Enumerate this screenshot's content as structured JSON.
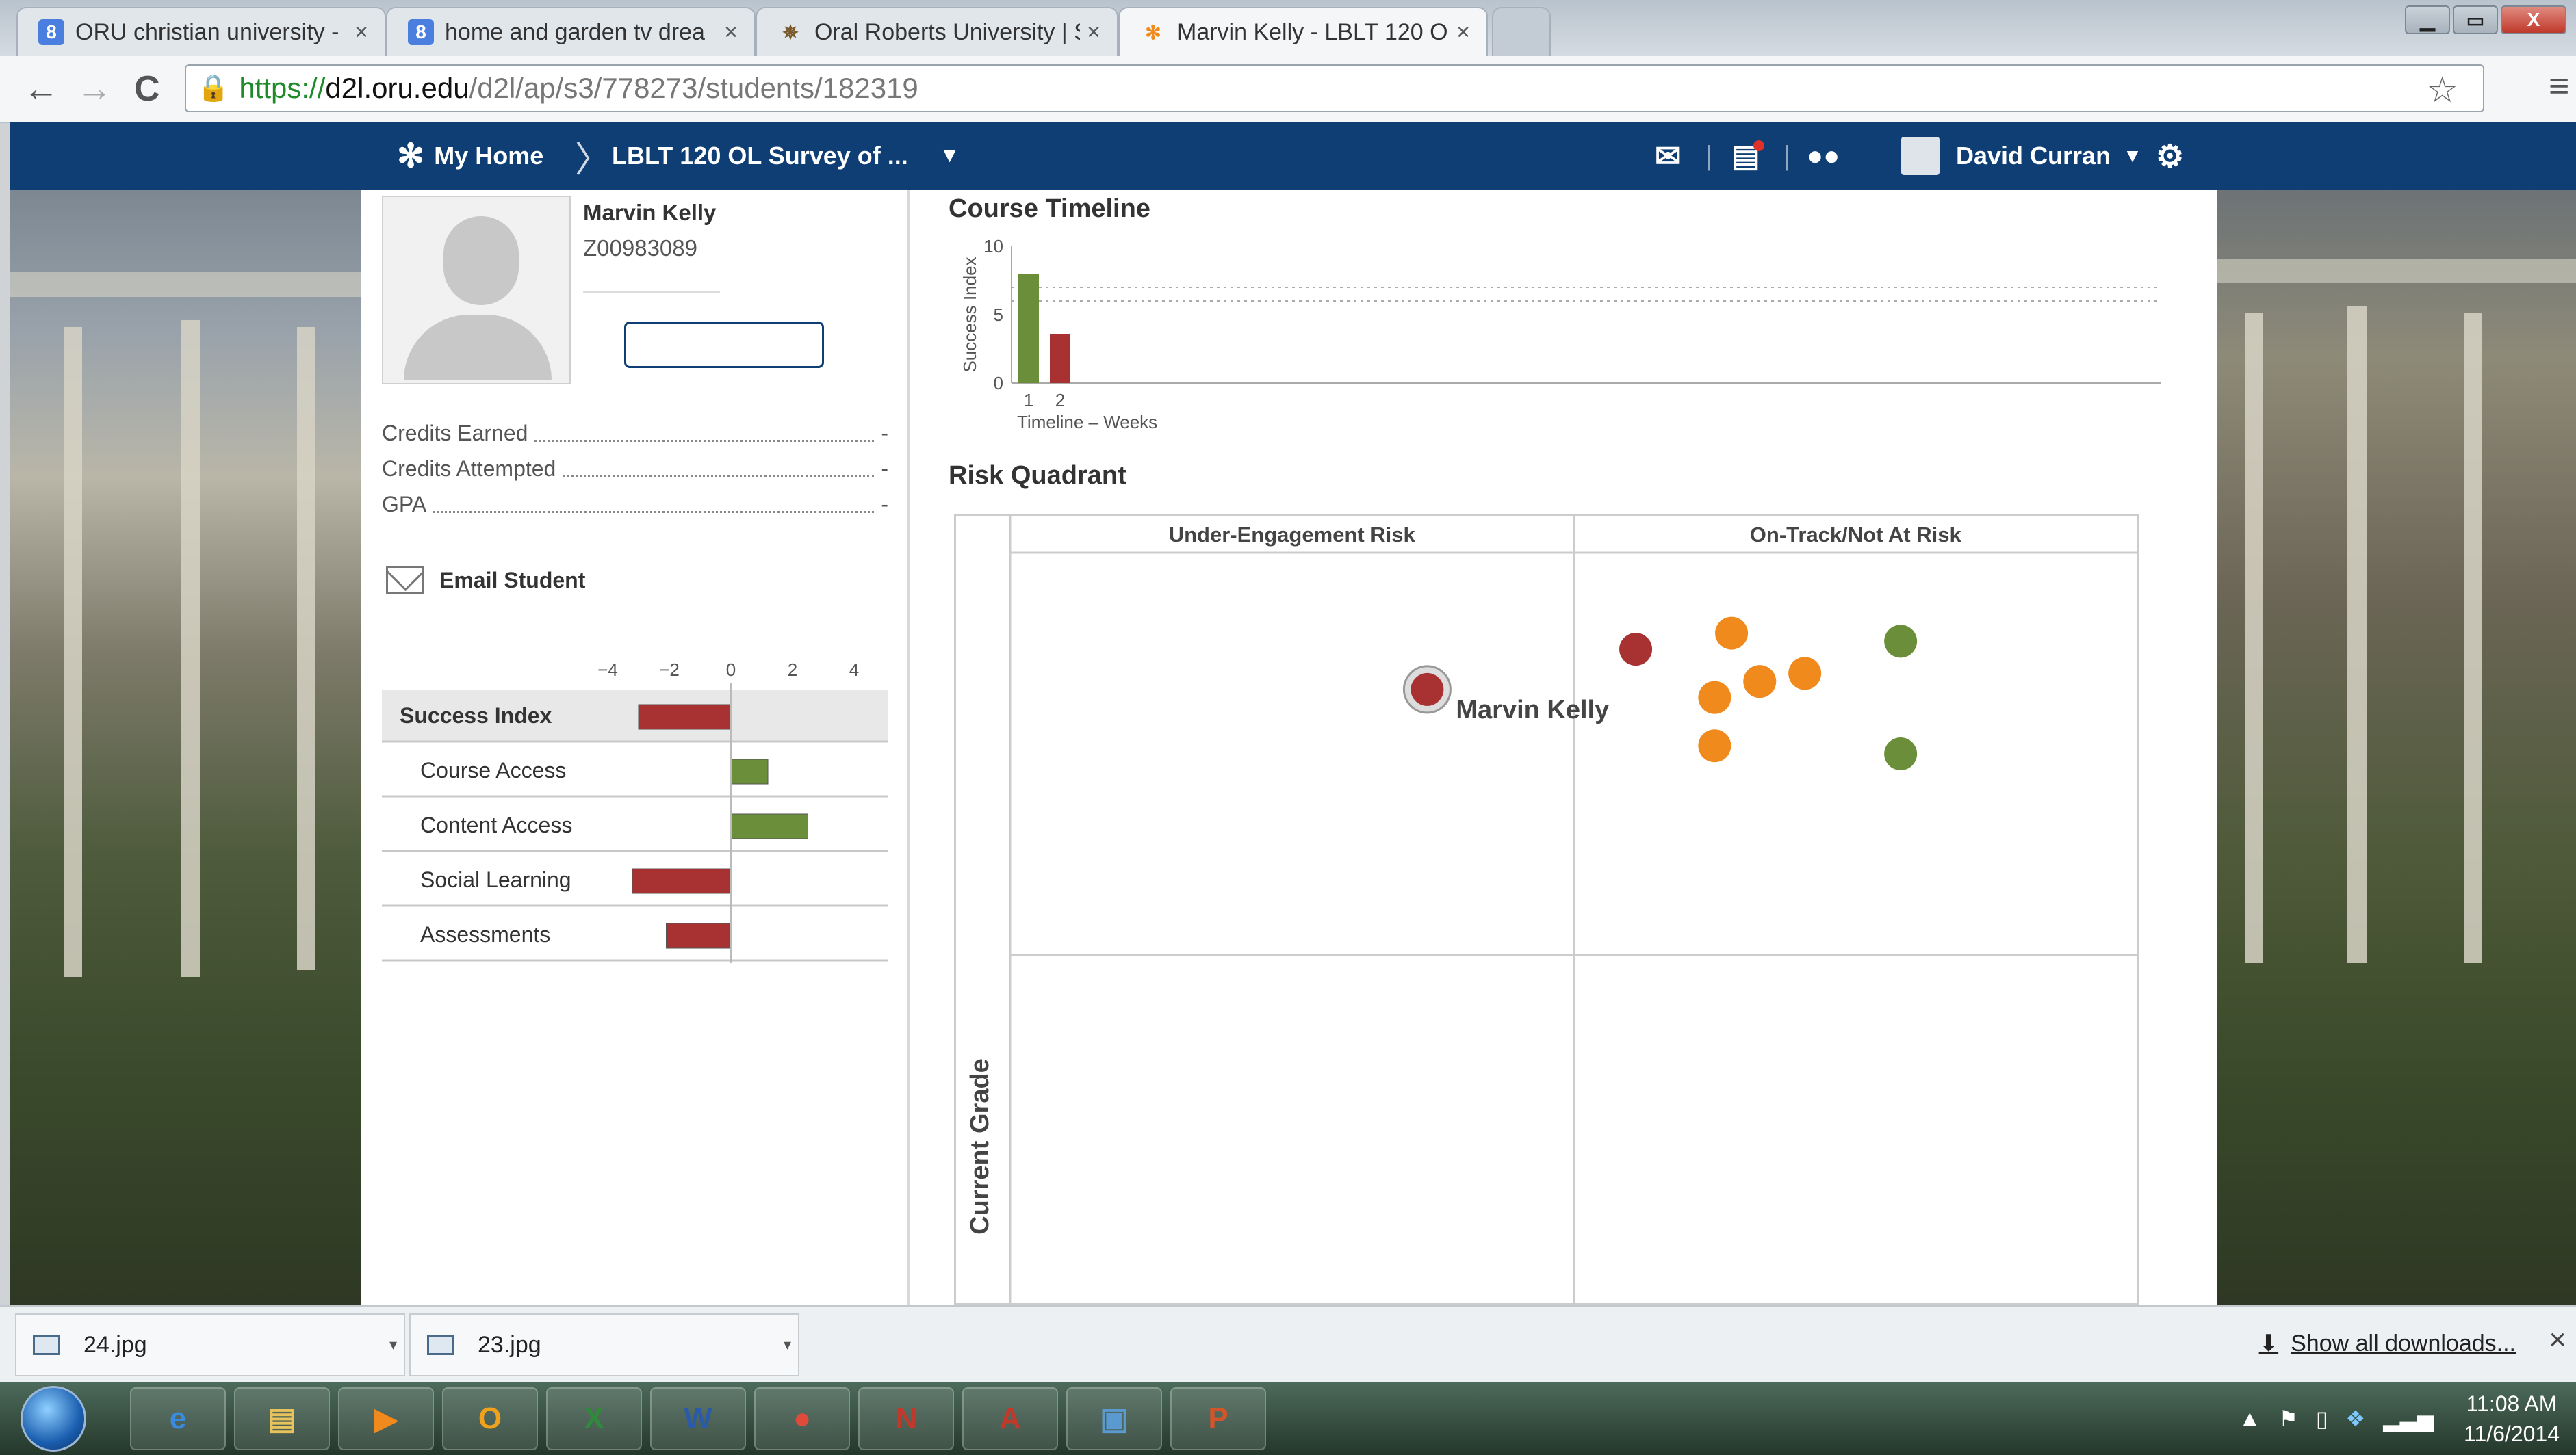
{
  "browser": {
    "tabs": [
      {
        "title": "ORU christian university -",
        "icon": "google-icon",
        "icon_glyph": "8",
        "icon_color": "#4a7fe0"
      },
      {
        "title": "home and garden tv drea",
        "icon": "google-icon",
        "icon_glyph": "8",
        "icon_color": "#4a7fe0"
      },
      {
        "title": "Oral Roberts University | S",
        "icon": "oru-icon",
        "icon_glyph": "✵",
        "icon_color": "#7a5a2a"
      },
      {
        "title": "Marvin Kelly - LBLT 120 O",
        "icon": "d2l-icon",
        "icon_glyph": "✻",
        "icon_color": "#f08a1c"
      }
    ],
    "tab_close": "×",
    "url_scheme": "https://",
    "url_host": "d2l.oru.edu",
    "url_path": "/d2l/ap/s3/778273/students/182319",
    "nav_back": "←",
    "nav_forward": "→",
    "nav_reload": "C",
    "window_minimize": "▁",
    "window_restore": "▭",
    "window_close": "X"
  },
  "navbar": {
    "home_label": "My Home",
    "course_label": "LBLT 120 OL Survey of ...",
    "user_name": "David Curran",
    "colors": {
      "bar": "#0e3e73"
    }
  },
  "student": {
    "name": "Marvin Kelly",
    "id": "Z00983089",
    "stats": [
      {
        "label": "Credits Earned",
        "value": "-"
      },
      {
        "label": "Credits Attempted",
        "value": "-"
      },
      {
        "label": "GPA",
        "value": "-"
      }
    ],
    "email_label": "Email Student"
  },
  "success_chart": {
    "axis_ticks": [
      "−4",
      "−2",
      "0",
      "2",
      "4"
    ],
    "axis_range": [
      -4,
      4
    ],
    "rows": [
      {
        "label": "Success Index",
        "value": -3.0,
        "bold": true
      },
      {
        "label": "Course Access",
        "value": 1.2
      },
      {
        "label": "Content Access",
        "value": 2.5
      },
      {
        "label": "Social Learning",
        "value": -3.2
      },
      {
        "label": "Assessments",
        "value": -2.1
      }
    ],
    "colors": {
      "positive": "#6b8e3a",
      "negative": "#a83232"
    }
  },
  "chart_data": [
    {
      "type": "bar",
      "title": "Course Timeline",
      "ylabel": "Success Index",
      "xlabel": "Timeline – Weeks",
      "categories": [
        "1",
        "2"
      ],
      "values": [
        8,
        3.6
      ],
      "ylim": [
        0,
        10
      ],
      "yticks": [
        "0",
        "5",
        "10"
      ],
      "colors": [
        "#6b8e3a",
        "#a83232"
      ],
      "grid": "dotted"
    },
    {
      "type": "scatter",
      "title": "Risk Quadrant",
      "ylabel": "Current Grade",
      "quadrant_labels": [
        "Under-Engagement Risk",
        "On-Track/Not At Risk"
      ],
      "highlight_label": "Marvin Kelly",
      "points": [
        {
          "x": 0.74,
          "y": 0.66,
          "color": "#a83232",
          "highlight": true
        },
        {
          "x": 1.11,
          "y": 0.76,
          "color": "#a83232"
        },
        {
          "x": 1.28,
          "y": 0.8,
          "color": "#f08a1c"
        },
        {
          "x": 1.58,
          "y": 0.78,
          "color": "#6b8e3a"
        },
        {
          "x": 1.41,
          "y": 0.7,
          "color": "#f08a1c"
        },
        {
          "x": 1.33,
          "y": 0.68,
          "color": "#f08a1c"
        },
        {
          "x": 1.25,
          "y": 0.64,
          "color": "#f08a1c"
        },
        {
          "x": 1.25,
          "y": 0.52,
          "color": "#f08a1c"
        },
        {
          "x": 1.58,
          "y": 0.5,
          "color": "#6b8e3a"
        }
      ],
      "xlim": [
        0,
        2
      ],
      "ylim": [
        -1,
        1
      ]
    }
  ],
  "downloads": {
    "items": [
      {
        "name": "24.jpg"
      },
      {
        "name": "23.jpg"
      }
    ],
    "show_all": "Show all downloads...",
    "close": "×"
  },
  "taskbar": {
    "apps": [
      {
        "name": "internet-explorer",
        "glyph": "e",
        "color": "#3a8be0"
      },
      {
        "name": "file-explorer",
        "glyph": "▤",
        "color": "#e8c25a"
      },
      {
        "name": "media-player",
        "glyph": "▶",
        "color": "#f08a1c"
      },
      {
        "name": "outlook",
        "glyph": "O",
        "color": "#f0a21c"
      },
      {
        "name": "excel",
        "glyph": "X",
        "color": "#2f8a3a"
      },
      {
        "name": "word",
        "glyph": "W",
        "color": "#2b5aa8"
      },
      {
        "name": "chrome",
        "glyph": "●",
        "color": "#e04a3a"
      },
      {
        "name": "notes",
        "glyph": "N",
        "color": "#c0392b"
      },
      {
        "name": "acrobat",
        "glyph": "A",
        "color": "#c0392b"
      },
      {
        "name": "photos",
        "glyph": "▣",
        "color": "#5a9ad0"
      },
      {
        "name": "powerpoint",
        "glyph": "P",
        "color": "#d2552a"
      }
    ],
    "time": "11:08 AM",
    "date": "11/6/2014"
  }
}
